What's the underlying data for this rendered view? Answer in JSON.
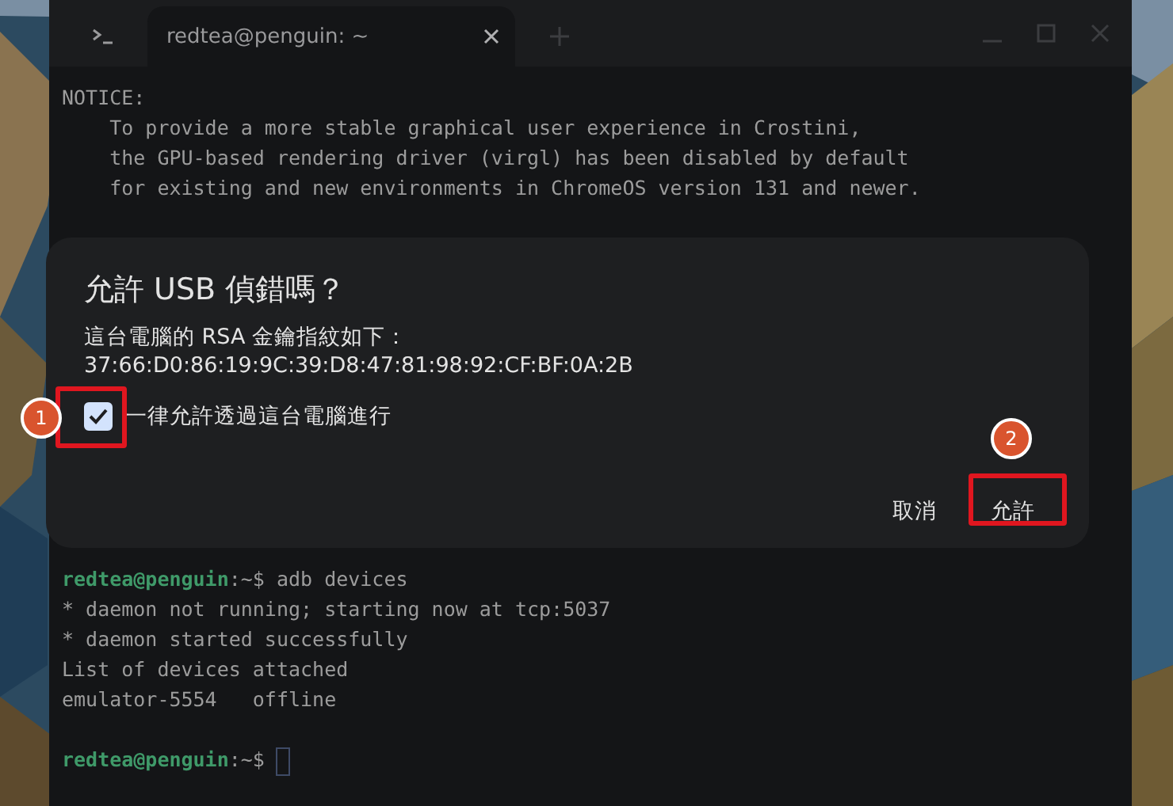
{
  "terminal": {
    "tabs": [
      {
        "label": "redtea@penguin: ~",
        "selected": true
      }
    ],
    "lines": [
      {
        "kind": "text",
        "text": "NOTICE:"
      },
      {
        "kind": "text",
        "text": "    To provide a more stable graphical user experience in Crostini,"
      },
      {
        "kind": "text",
        "text": "    the GPU-based rendering driver (virgl) has been disabled by default"
      },
      {
        "kind": "text",
        "text": "    for existing and new environments in ChromeOS version 131 and newer."
      }
    ],
    "lines_below": [
      {
        "kind": "prompt",
        "user": "redtea@penguin",
        "path": ":~$",
        "command": "adb devices"
      },
      {
        "kind": "text",
        "text": "* daemon not running; starting now at tcp:5037"
      },
      {
        "kind": "text",
        "text": "* daemon started successfully"
      },
      {
        "kind": "text",
        "text": "List of devices attached"
      },
      {
        "kind": "text",
        "text": "emulator-5554   offline"
      },
      {
        "kind": "blank"
      },
      {
        "kind": "prompt",
        "user": "redtea@penguin",
        "path": ":~$",
        "cursor": true
      }
    ]
  },
  "dialog": {
    "title": "允許 USB 偵錯嗎？",
    "message": "這台電腦的 RSA 金鑰指紋如下：",
    "fingerprint": "37:66:D0:86:19:9C:39:D8:47:81:98:92:CF:BF:0A:2B",
    "checkbox": {
      "label": "一律允許透過這台電腦進行",
      "checked": true,
      "callout": "1"
    },
    "buttons": [
      {
        "label": "取消"
      },
      {
        "label": "允許",
        "callout": "2"
      }
    ]
  }
}
